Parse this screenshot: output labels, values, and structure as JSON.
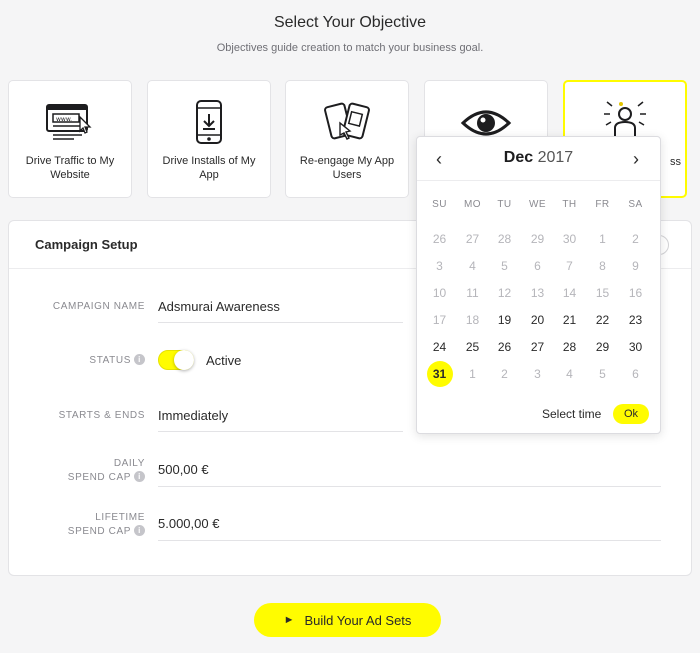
{
  "header": {
    "title": "Select Your Objective",
    "subtitle": "Objectives guide creation to match your business goal."
  },
  "objectives": [
    {
      "label": "Drive Traffic to My Website",
      "icon": "browser-window-icon"
    },
    {
      "label": "Drive Installs of My App",
      "icon": "phone-download-icon"
    },
    {
      "label": "Re-engage My App Users",
      "icon": "phones-reengage-icon"
    },
    {
      "label": "",
      "icon": "eye-icon"
    },
    {
      "label": "ss",
      "icon": "awareness-person-icon",
      "selected": true
    }
  ],
  "campaign": {
    "title": "Campaign Setup",
    "name_label": "CAMPAIGN NAME",
    "name_value": "Adsmurai Awareness",
    "status_label": "STATUS",
    "status_value": "Active",
    "starts_label": "STARTS & ENDS",
    "starts_value": "Immediately",
    "daily_label_1": "DAILY",
    "daily_label_2": "SPEND CAP",
    "daily_value": "500,00 €",
    "lifetime_label_1": "LIFETIME",
    "lifetime_label_2": "SPEND CAP",
    "lifetime_value": "5.000,00 €"
  },
  "calendar": {
    "month": "Dec",
    "year": "2017",
    "prev": "‹",
    "next": "›",
    "weekdays": [
      "SU",
      "MO",
      "TU",
      "WE",
      "TH",
      "FR",
      "SA"
    ],
    "weeks": [
      [
        {
          "d": "26",
          "out": true
        },
        {
          "d": "27",
          "out": true
        },
        {
          "d": "28",
          "out": true
        },
        {
          "d": "29",
          "out": true
        },
        {
          "d": "30",
          "out": true
        },
        {
          "d": "1",
          "out": true
        },
        {
          "d": "2",
          "out": true
        }
      ],
      [
        {
          "d": "3",
          "out": true
        },
        {
          "d": "4",
          "out": true
        },
        {
          "d": "5",
          "out": true
        },
        {
          "d": "6",
          "out": true
        },
        {
          "d": "7",
          "out": true
        },
        {
          "d": "8",
          "out": true
        },
        {
          "d": "9",
          "out": true
        }
      ],
      [
        {
          "d": "10",
          "out": true
        },
        {
          "d": "11",
          "out": true
        },
        {
          "d": "12",
          "out": true
        },
        {
          "d": "13",
          "out": true
        },
        {
          "d": "14",
          "out": true
        },
        {
          "d": "15",
          "out": true
        },
        {
          "d": "16",
          "out": true
        }
      ],
      [
        {
          "d": "17",
          "out": true
        },
        {
          "d": "18",
          "out": true
        },
        {
          "d": "19",
          "out": false
        },
        {
          "d": "20",
          "out": false
        },
        {
          "d": "21",
          "out": false
        },
        {
          "d": "22",
          "out": false
        },
        {
          "d": "23",
          "out": false
        }
      ],
      [
        {
          "d": "24",
          "out": false
        },
        {
          "d": "25",
          "out": false
        },
        {
          "d": "26",
          "out": false
        },
        {
          "d": "27",
          "out": false
        },
        {
          "d": "28",
          "out": false
        },
        {
          "d": "29",
          "out": false
        },
        {
          "d": "30",
          "out": false
        }
      ],
      [
        {
          "d": "31",
          "out": false,
          "selected": true
        },
        {
          "d": "1",
          "out": true
        },
        {
          "d": "2",
          "out": true
        },
        {
          "d": "3",
          "out": true
        },
        {
          "d": "4",
          "out": true
        },
        {
          "d": "5",
          "out": true
        },
        {
          "d": "6",
          "out": true
        }
      ]
    ],
    "select_time": "Select time",
    "ok": "Ok"
  },
  "cta": {
    "label": "Build Your Ad Sets"
  },
  "colors": {
    "accent": "#fffc00",
    "background": "#f5f5f6"
  }
}
